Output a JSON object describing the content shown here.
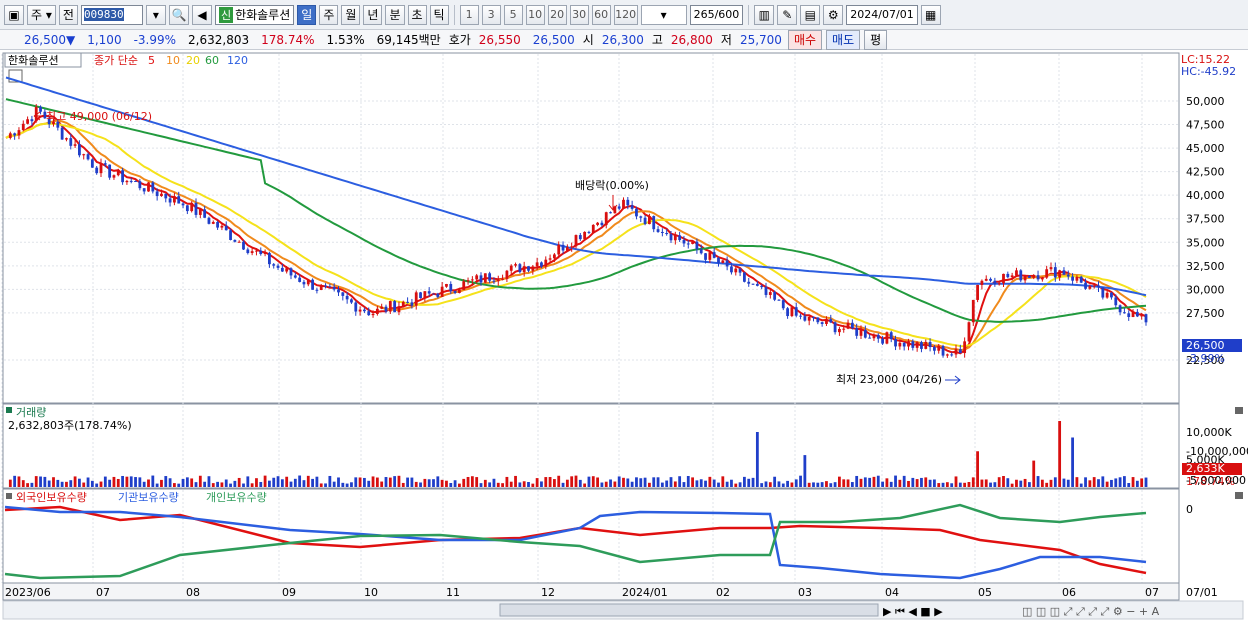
{
  "toolbar": {
    "period_type": "주",
    "compare": "전",
    "code": "009830",
    "listing_badge": "신",
    "stock_name": "한화솔루션",
    "timeframes": [
      "일",
      "주",
      "월",
      "년",
      "분",
      "초",
      "틱"
    ],
    "active_timeframe": "일",
    "intervals": [
      "1",
      "3",
      "5",
      "10",
      "20",
      "30",
      "60",
      "120"
    ],
    "count_display": "265",
    "count_total": "/600",
    "date": "2024/07/01"
  },
  "infobar": {
    "price": "26,500▼",
    "change": "1,100",
    "change_pct": "-3.99%",
    "volume": "2,632,803",
    "volume_ratio": "178.74%",
    "turnover": "1.53%",
    "amount": "69,145백만",
    "quote_label": "호가",
    "ask": "26,550",
    "bid": "26,500",
    "open_label": "시",
    "open": "26,300",
    "high_label": "고",
    "high": "26,800",
    "low_label": "저",
    "low": "25,700",
    "buy_button": "매수",
    "sell_button": "매도",
    "eval_button": "평"
  },
  "price_panel": {
    "stock_tag": "한화솔루션",
    "legend_prefix": "종가 단순",
    "ma_labels": [
      "5",
      "10",
      "20",
      "60",
      "120"
    ],
    "lc": "LC:15.22",
    "hc": "HC:-45.92",
    "annot_high": "최고 49,000 (06/12)",
    "annot_low": "최저 23,000 (04/26)",
    "annot_dividend": "배당락(0.00%)",
    "y_ticks": [
      "50,000",
      "47,500",
      "45,000",
      "42,500",
      "40,000",
      "37,500",
      "35,000",
      "32,500",
      "30,000",
      "27,500",
      "22,500"
    ],
    "current_price_tag": "26,500",
    "current_change_tag": "-3.99%"
  },
  "volume_panel": {
    "title": "거래량",
    "value": "2,632,803주(178.74%)",
    "y_ticks": [
      "10,000K",
      "5,000K"
    ],
    "current_tag": "2,633K",
    "current_ratio": "178.74%"
  },
  "holdings_panel": {
    "legend": [
      "외국인보유수량",
      "기관보유수량",
      "개인보유수량"
    ],
    "y_ticks": [
      "0",
      "-5,000,000",
      "-10,000,000"
    ]
  },
  "x_axis": {
    "labels": [
      "2023/06",
      "07",
      "08",
      "09",
      "10",
      "11",
      "12",
      "2024/01",
      "02",
      "03",
      "04",
      "05",
      "06",
      "07"
    ],
    "right_label": "07/01"
  },
  "colors": {
    "up": "#d80f0f",
    "down": "#1f3ec9",
    "ma5": "#e01010",
    "ma10": "#f08a1c",
    "ma20": "#f5e21b",
    "ma60": "#229a3e",
    "ma120": "#2c5ee0",
    "foreign": "#e01010",
    "institution": "#2c5ee0",
    "individual": "#2e9c5a"
  },
  "chart_data": {
    "type": "candlestick",
    "series_points": [
      {
        "date": "2023/06",
        "close": 46000
      },
      {
        "date": "06/12",
        "close": 49000
      },
      {
        "date": "07",
        "close": 43000
      },
      {
        "date": "08",
        "close": 39000
      },
      {
        "date": "09",
        "close": 32000
      },
      {
        "date": "10",
        "close": 27500
      },
      {
        "date": "11",
        "close": 30000
      },
      {
        "date": "12",
        "close": 33000
      },
      {
        "date": "2024/01",
        "close": 39000
      },
      {
        "date": "02",
        "close": 33000
      },
      {
        "date": "03",
        "close": 27000
      },
      {
        "date": "04/26",
        "close": 23000
      },
      {
        "date": "05",
        "close": 31000
      },
      {
        "date": "06",
        "close": 32000
      },
      {
        "date": "07/01",
        "close": 26500
      }
    ]
  }
}
